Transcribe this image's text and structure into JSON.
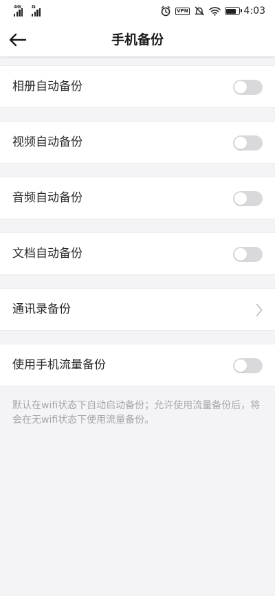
{
  "status_bar": {
    "signal1_tag": "4G",
    "signal2_tag": "G",
    "vpn_label": "VPN",
    "time": "4:03"
  },
  "header": {
    "title": "手机备份"
  },
  "settings": [
    {
      "label": "相册自动备份",
      "control": "toggle",
      "on": false
    },
    {
      "label": "视频自动备份",
      "control": "toggle",
      "on": false
    },
    {
      "label": "音频自动备份",
      "control": "toggle",
      "on": false
    },
    {
      "label": "文档自动备份",
      "control": "toggle",
      "on": false
    },
    {
      "label": "通讯录备份",
      "control": "chevron"
    },
    {
      "label": "使用手机流量备份",
      "control": "toggle",
      "on": false
    }
  ],
  "footer_note": "默认在wifi状态下自动启动备份；允许使用流量备份后，将会在无wifi状态下使用流量备份。",
  "colors": {
    "background": "#f4f4f6",
    "toggle_off": "#d9d9db",
    "note_text": "#a6a6a8"
  }
}
